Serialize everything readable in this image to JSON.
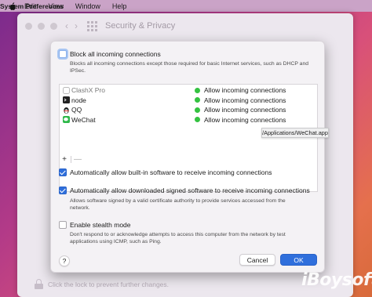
{
  "menubar": {
    "app": "System Preferences",
    "items": [
      "Edit",
      "View",
      "Window",
      "Help"
    ]
  },
  "window": {
    "title": "Security & Privacy",
    "lock_text": "Click the lock to prevent further changes."
  },
  "dialog": {
    "block_all": {
      "label": "Block all incoming connections",
      "checked": false,
      "description": "Blocks all incoming connections except those required for basic Internet services, such as DHCP and IPSec."
    },
    "apps": [
      {
        "name": "ClashX Pro",
        "status": "Allow incoming connections"
      },
      {
        "name": "node",
        "status": "Allow incoming connections"
      },
      {
        "name": "QQ",
        "status": "Allow incoming connections"
      },
      {
        "name": "WeChat",
        "status": "Allow incoming connections"
      }
    ],
    "tooltip": "/Applications/WeChat.app",
    "add_label": "+",
    "remove_label": "—",
    "auto_builtin": {
      "label": "Automatically allow built-in software to receive incoming connections",
      "checked": true
    },
    "auto_signed": {
      "label": "Automatically allow downloaded signed software to receive incoming connections",
      "checked": true,
      "description": "Allows software signed by a valid certificate authority to provide services accessed from the network."
    },
    "stealth": {
      "label": "Enable stealth mode",
      "checked": false,
      "description": "Don't respond to or acknowledge attempts to access this computer from the network by test applications using ICMP, such as Ping."
    },
    "help_label": "?",
    "cancel_label": "Cancel",
    "ok_label": "OK"
  },
  "watermark": "iBoysoft",
  "colors": {
    "accent": "#2f6fdc",
    "status_green": "#34c241"
  },
  "icons": {
    "apple": "apple-icon",
    "lock": "lock-icon"
  }
}
